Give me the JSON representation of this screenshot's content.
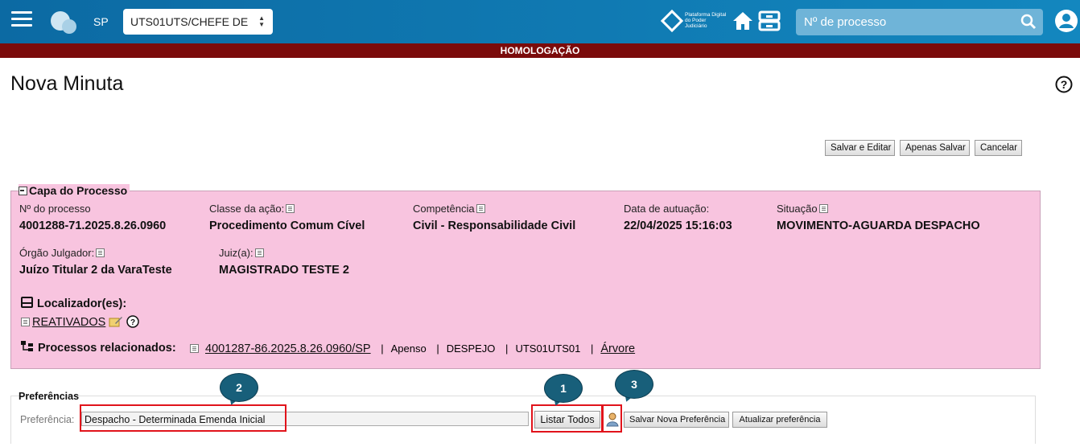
{
  "header": {
    "state": "SP",
    "org_select": "UTS01UTS/CHEFE DE",
    "platform_logo_text": "Plataforma Digital do Poder Judiciário",
    "search_placeholder": "Nº de processo"
  },
  "env_banner": "HOMOLOGAÇÃO",
  "page_title": "Nova Minuta",
  "actions": {
    "save_edit": "Salvar e Editar",
    "save_only": "Apenas Salvar",
    "cancel": "Cancelar"
  },
  "capa": {
    "title": "Capa do Processo",
    "fields": [
      {
        "label": "Nº do processo",
        "value": "4001288-71.2025.8.26.0960"
      },
      {
        "label": "Classe da ação:",
        "value": "Procedimento Comum Cível"
      },
      {
        "label": "Competência",
        "value": "Civil - Responsabilidade Civil"
      },
      {
        "label": "Data de autuação:",
        "value": "22/04/2025 15:16:03"
      },
      {
        "label": "Situação",
        "value": "MOVIMENTO-AGUARDA DESPACHO"
      },
      {
        "label": "Órgão Julgador:",
        "value": "Juízo Titular 2 da VaraTeste"
      },
      {
        "label": "Juiz(a):",
        "value": "MAGISTRADO TESTE 2"
      }
    ],
    "localizadores_label": "Localizador(es):",
    "localizador": "REATIVADOS",
    "relacionados_label": "Processos relacionados:",
    "relacionado": {
      "numero": "4001287-86.2025.8.26.0960/SP",
      "sep": "|",
      "tipo": "Apenso",
      "classe": "DESPEJO",
      "orgao": "UTS01UTS01",
      "arvore": "Árvore"
    }
  },
  "preferencias": {
    "title": "Preferências",
    "label": "Preferência:",
    "value": "Despacho - Determinada Emenda Inicial",
    "listar_todos": "Listar Todos",
    "salvar_nova": "Salvar Nova Preferência",
    "atualizar": "Atualizar preferência"
  },
  "callouts": [
    "1",
    "2",
    "3"
  ],
  "colors": {
    "topbar": "#0c6aa3",
    "banner": "#7b0b0b",
    "capa_bg": "#f8c4df",
    "highlight": "#e1131b",
    "callout": "#185f7a"
  }
}
